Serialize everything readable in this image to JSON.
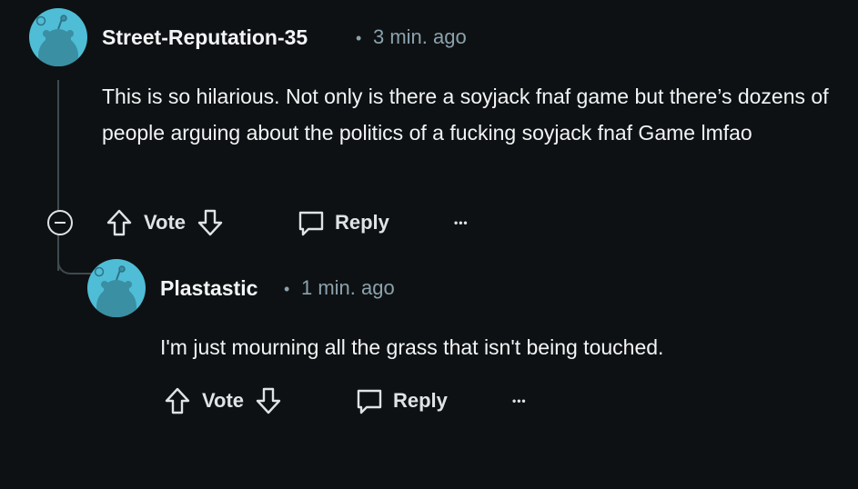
{
  "comments": [
    {
      "author": "Street-Reputation-35",
      "separator": "•",
      "time": "3 min. ago",
      "body": "This is so hilarious. Not only is there a soyjack fnaf game but there’s dozens of people arguing about the politics of a fucking soyjack fnaf Game lmfao",
      "vote_label": "Vote",
      "reply_label": "Reply",
      "more_label": "•••",
      "avatar_color": "#4fbdd6"
    },
    {
      "author": "Plastastic",
      "separator": "•",
      "time": "1 min. ago",
      "body": "I'm just mourning all the grass that isn't being touched.",
      "vote_label": "Vote",
      "reply_label": "Reply",
      "more_label": "•••",
      "avatar_color": "#4fbdd6"
    }
  ],
  "icons": {
    "upvote": "arrow-up-icon",
    "downvote": "arrow-down-icon",
    "reply": "speech-bubble-icon",
    "collapse": "collapse-minus-icon"
  }
}
